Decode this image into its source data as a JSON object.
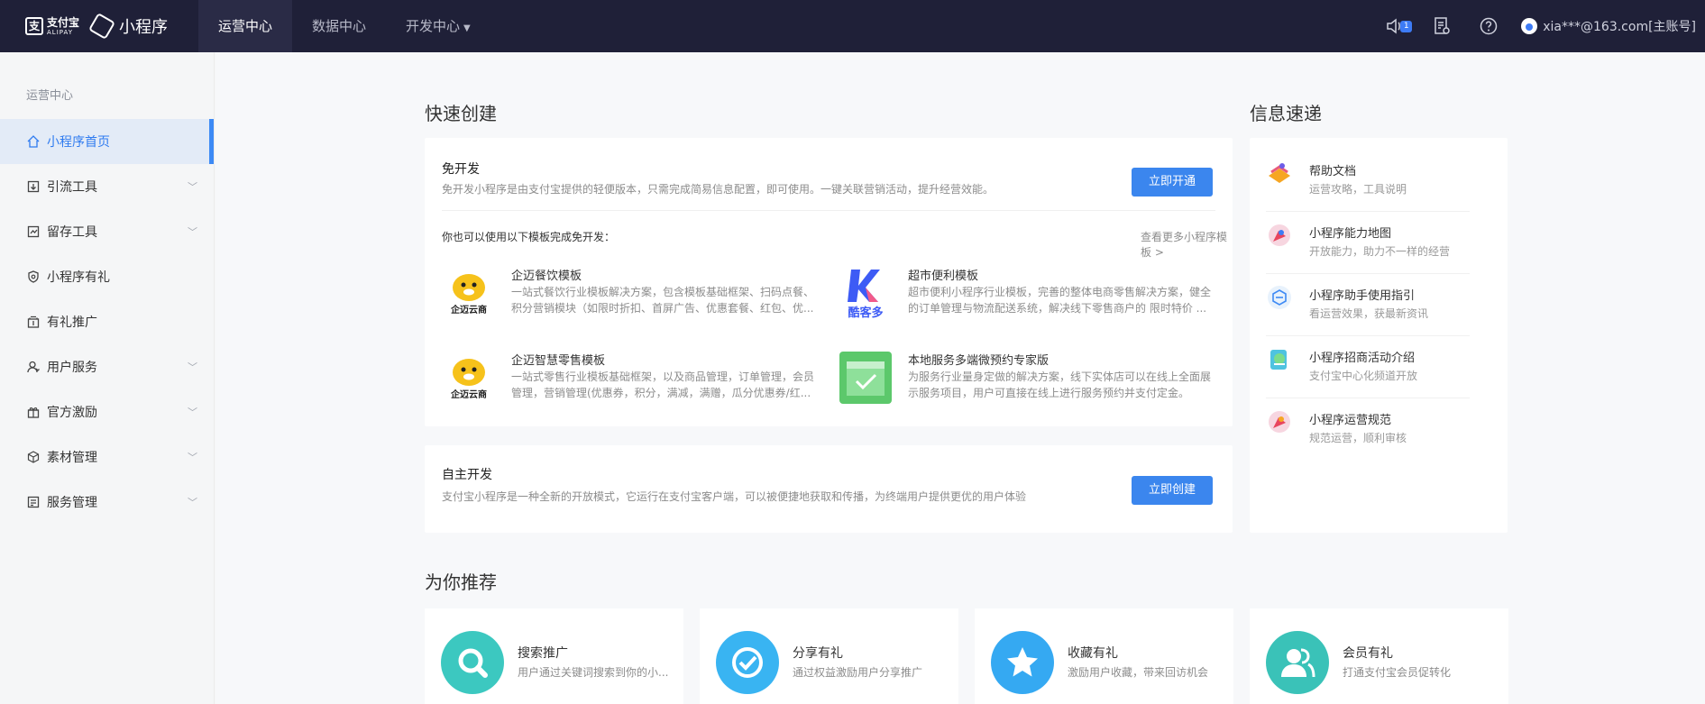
{
  "brand": {
    "alipay_cn": "支付宝",
    "alipay_en": "ALIPAY",
    "product": "小程序"
  },
  "topnav": [
    {
      "label": "运营中心",
      "active": true
    },
    {
      "label": "数据中心"
    },
    {
      "label": "开发中心"
    }
  ],
  "topright": {
    "badge": "1",
    "account": "xia***@163.com[主账号]"
  },
  "sidebar": {
    "section": "运营中心",
    "items": [
      {
        "label": "小程序首页",
        "icon": "home-icon"
      },
      {
        "label": "引流工具",
        "icon": "traffic-icon"
      },
      {
        "label": "留存工具",
        "icon": "retention-icon"
      },
      {
        "label": "小程序有礼",
        "icon": "gift-shield-icon"
      },
      {
        "label": "有礼推广",
        "icon": "promote-icon"
      },
      {
        "label": "用户服务",
        "icon": "user-icon"
      },
      {
        "label": "官方激励",
        "icon": "gift-box-icon"
      },
      {
        "label": "素材管理",
        "icon": "cube-icon"
      },
      {
        "label": "服务管理",
        "icon": "list-icon"
      }
    ]
  },
  "quick": {
    "title": "快速创建",
    "free": {
      "title": "免开发",
      "desc": "免开发小程序是由支付宝提供的轻便版本，只需完成简易信息配置，即可使用。一键关联营销活动，提升经营效能。",
      "button": "立即开通",
      "templates_hint": "你也可以使用以下模板完成免开发：",
      "more": "查看更多小程序模板 >",
      "templates": [
        {
          "name": "企迈餐饮模板",
          "desc": "一站式餐饮行业模板解决方案，包含模板基础框架、扫码点餐、积分营销模块（如限时折扣、首屏广告、优惠套餐、红包、优...",
          "logo_text": "企迈云商"
        },
        {
          "name": "超市便利模板",
          "desc": "超市便利小程序行业模板，完善的整体电商零售解决方案，健全的订单管理与物流配送系统，解决线下零售商户的 限时特价 ...",
          "logo_text": "酷客多"
        },
        {
          "name": "企迈智慧零售模板",
          "desc": "一站式零售行业模板基础框架，以及商品管理，订单管理，会员管理，营销管理(优惠券，积分，满减，满赠，瓜分优惠券/红...",
          "logo_text": "企迈云商"
        },
        {
          "name": "本地服务多端微预约专家版",
          "desc": "为服务行业量身定做的解决方案，线下实体店可以在线上全面展示服务项目，用户可直接在线上进行服务预约并支付定金。",
          "logo_text": ""
        }
      ]
    },
    "self": {
      "title": "自主开发",
      "desc": "支付宝小程序是一种全新的开放模式，它运行在支付宝客户端，可以被便捷地获取和传播，为终端用户提供更优的用户体验",
      "button": "立即创建"
    }
  },
  "info": {
    "title": "信息速递",
    "items": [
      {
        "title": "帮助文档",
        "desc": "运营攻略，工具说明",
        "icon": "book-icon"
      },
      {
        "title": "小程序能力地图",
        "desc": "开放能力，助力不一样的经营",
        "icon": "rocket-icon"
      },
      {
        "title": "小程序助手使用指引",
        "desc": "看运营效果，获最新资讯",
        "icon": "assistant-icon"
      },
      {
        "title": "小程序招商活动介绍",
        "desc": "支付宝中心化频道开放",
        "icon": "globe-icon"
      },
      {
        "title": "小程序运营规范",
        "desc": "规范运营，顺利审核",
        "icon": "rules-icon"
      }
    ]
  },
  "recommend": {
    "title": "为你推荐",
    "items": [
      {
        "title": "搜索推广",
        "desc": "用户通过关键词搜索到你的小...",
        "icon": "search-icon",
        "color": "#3cc8c0"
      },
      {
        "title": "分享有礼",
        "desc": "通过权益激励用户分享推广",
        "icon": "check-icon",
        "color": "#39b4f2"
      },
      {
        "title": "收藏有礼",
        "desc": "激励用户收藏，带来回访机会",
        "icon": "star-icon",
        "color": "#35a9f2"
      },
      {
        "title": "会员有礼",
        "desc": "打通支付宝会员促转化",
        "icon": "members-icon",
        "color": "#3ac2b8"
      }
    ]
  },
  "colors": {
    "topbar": "#1f2038",
    "accent": "#3b86ee"
  }
}
